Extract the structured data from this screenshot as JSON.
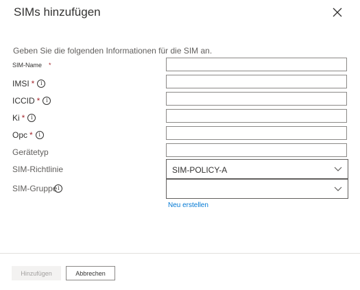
{
  "dialog": {
    "title": "SIMs hinzufügen",
    "intro": "Geben Sie die folgenden Informationen für die SIM an."
  },
  "fields": {
    "sim_name": {
      "label": "SIM-Name",
      "required": "*",
      "value": ""
    },
    "imsi": {
      "label": "IMSI",
      "required": "*",
      "info_icon": "i",
      "value": ""
    },
    "iccid": {
      "label": "ICCID",
      "required": "*",
      "info_icon": "i",
      "value": ""
    },
    "ki": {
      "label": "Ki",
      "required": "*",
      "info_icon": "i",
      "value": ""
    },
    "opc": {
      "label": "Opc",
      "required": "*",
      "info_icon": "i",
      "value": ""
    },
    "device_type": {
      "label": "Gerätetyp",
      "value": ""
    },
    "sim_policy": {
      "label": "SIM-Richtlinie",
      "value": "SIM-POLICY-A"
    },
    "sim_group": {
      "label": "SIM-Gruppe",
      "info_icon": "i",
      "value": ""
    }
  },
  "create_new_link": "Neu erstellen",
  "footer": {
    "add_label": "Hinzufügen",
    "cancel_label": "Abbrechen"
  },
  "colors": {
    "required": "#a4262c",
    "link": "#0078d4",
    "disabled_button_bg": "#f3f2f1",
    "disabled_button_text": "#a19f9d"
  },
  "icons": {
    "close": "close-icon",
    "info": "info-icon",
    "dropdown": "chevron-down-icon"
  }
}
